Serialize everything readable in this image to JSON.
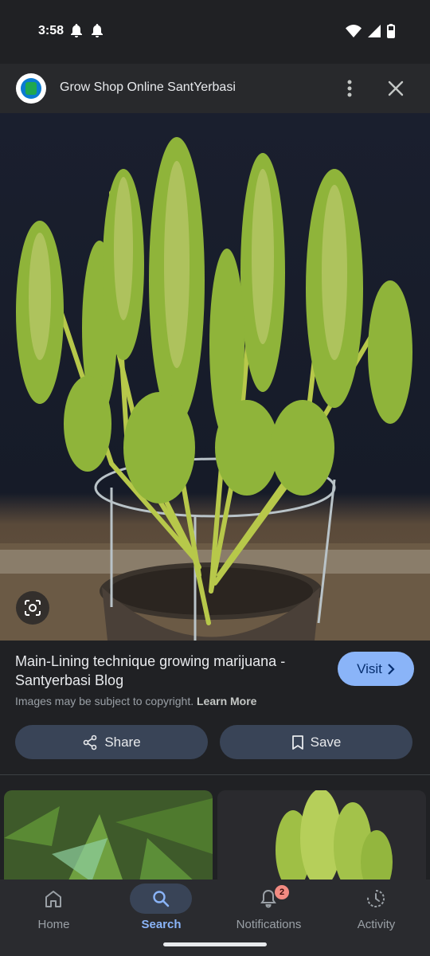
{
  "status_bar": {
    "time": "3:58"
  },
  "header": {
    "site_name": "Grow Shop Online SantYerbasi"
  },
  "result": {
    "title": "Main-Lining technique growing marijuana - Santyerbasi Blog",
    "copyright_text": "Images may be subject to copyright.",
    "learn_more": "Learn More",
    "visit_label": "Visit"
  },
  "actions": {
    "share_label": "Share",
    "save_label": "Save"
  },
  "bottom_nav": {
    "items": [
      {
        "label": "Home",
        "icon": "home-icon",
        "active": false
      },
      {
        "label": "Search",
        "icon": "search-icon",
        "active": true
      },
      {
        "label": "Notifications",
        "icon": "bell-icon",
        "active": false,
        "badge": "2"
      },
      {
        "label": "Activity",
        "icon": "history-icon",
        "active": false
      }
    ]
  },
  "colors": {
    "accent": "#8ab4f8",
    "background": "#202124",
    "button": "#394457",
    "badge": "#f28b82"
  }
}
